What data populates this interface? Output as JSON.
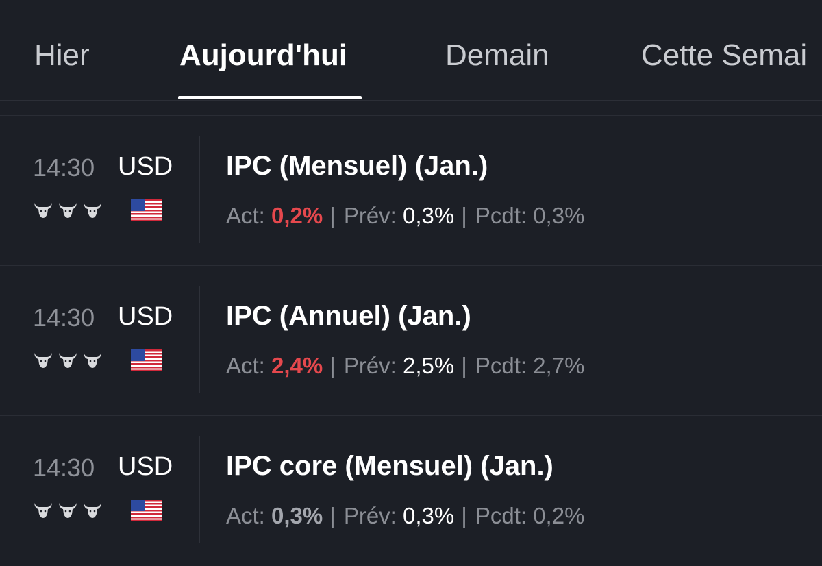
{
  "tabs": [
    {
      "label": "Hier"
    },
    {
      "label": "Aujourd'hui"
    },
    {
      "label": "Demain"
    },
    {
      "label": "Cette Semai"
    }
  ],
  "active_tab": "Aujourd'hui",
  "colors": {
    "background": "#1c1f26",
    "negative": "#e5484d",
    "muted": "#8b8e95"
  },
  "events": [
    {
      "time": "14:30",
      "currency": "USD",
      "importance": 3,
      "importance_icon": "bull-icon",
      "flag": "us-flag-icon",
      "title": "IPC (Mensuel) (Jan.)",
      "act_label": "Act:",
      "act_value": "0,2%",
      "act_status": "negative",
      "sep1": "|",
      "prev_label": "Prév:",
      "prev_value": "0,3%",
      "sep2": "|",
      "pcdt_label": "Pcdt:",
      "pcdt_value": "0,3%"
    },
    {
      "time": "14:30",
      "currency": "USD",
      "importance": 3,
      "importance_icon": "bull-icon",
      "flag": "us-flag-icon",
      "title": "IPC (Annuel) (Jan.)",
      "act_label": "Act:",
      "act_value": "2,4%",
      "act_status": "negative",
      "sep1": "|",
      "prev_label": "Prév:",
      "prev_value": "2,5%",
      "sep2": "|",
      "pcdt_label": "Pcdt:",
      "pcdt_value": "2,7%"
    },
    {
      "time": "14:30",
      "currency": "USD",
      "importance": 3,
      "importance_icon": "bull-icon",
      "flag": "us-flag-icon",
      "title": "IPC core (Mensuel) (Jan.)",
      "act_label": "Act:",
      "act_value": "0,3%",
      "act_status": "neutral",
      "sep1": "|",
      "prev_label": "Prév:",
      "prev_value": "0,3%",
      "sep2": "|",
      "pcdt_label": "Pcdt:",
      "pcdt_value": "0,2%"
    }
  ]
}
